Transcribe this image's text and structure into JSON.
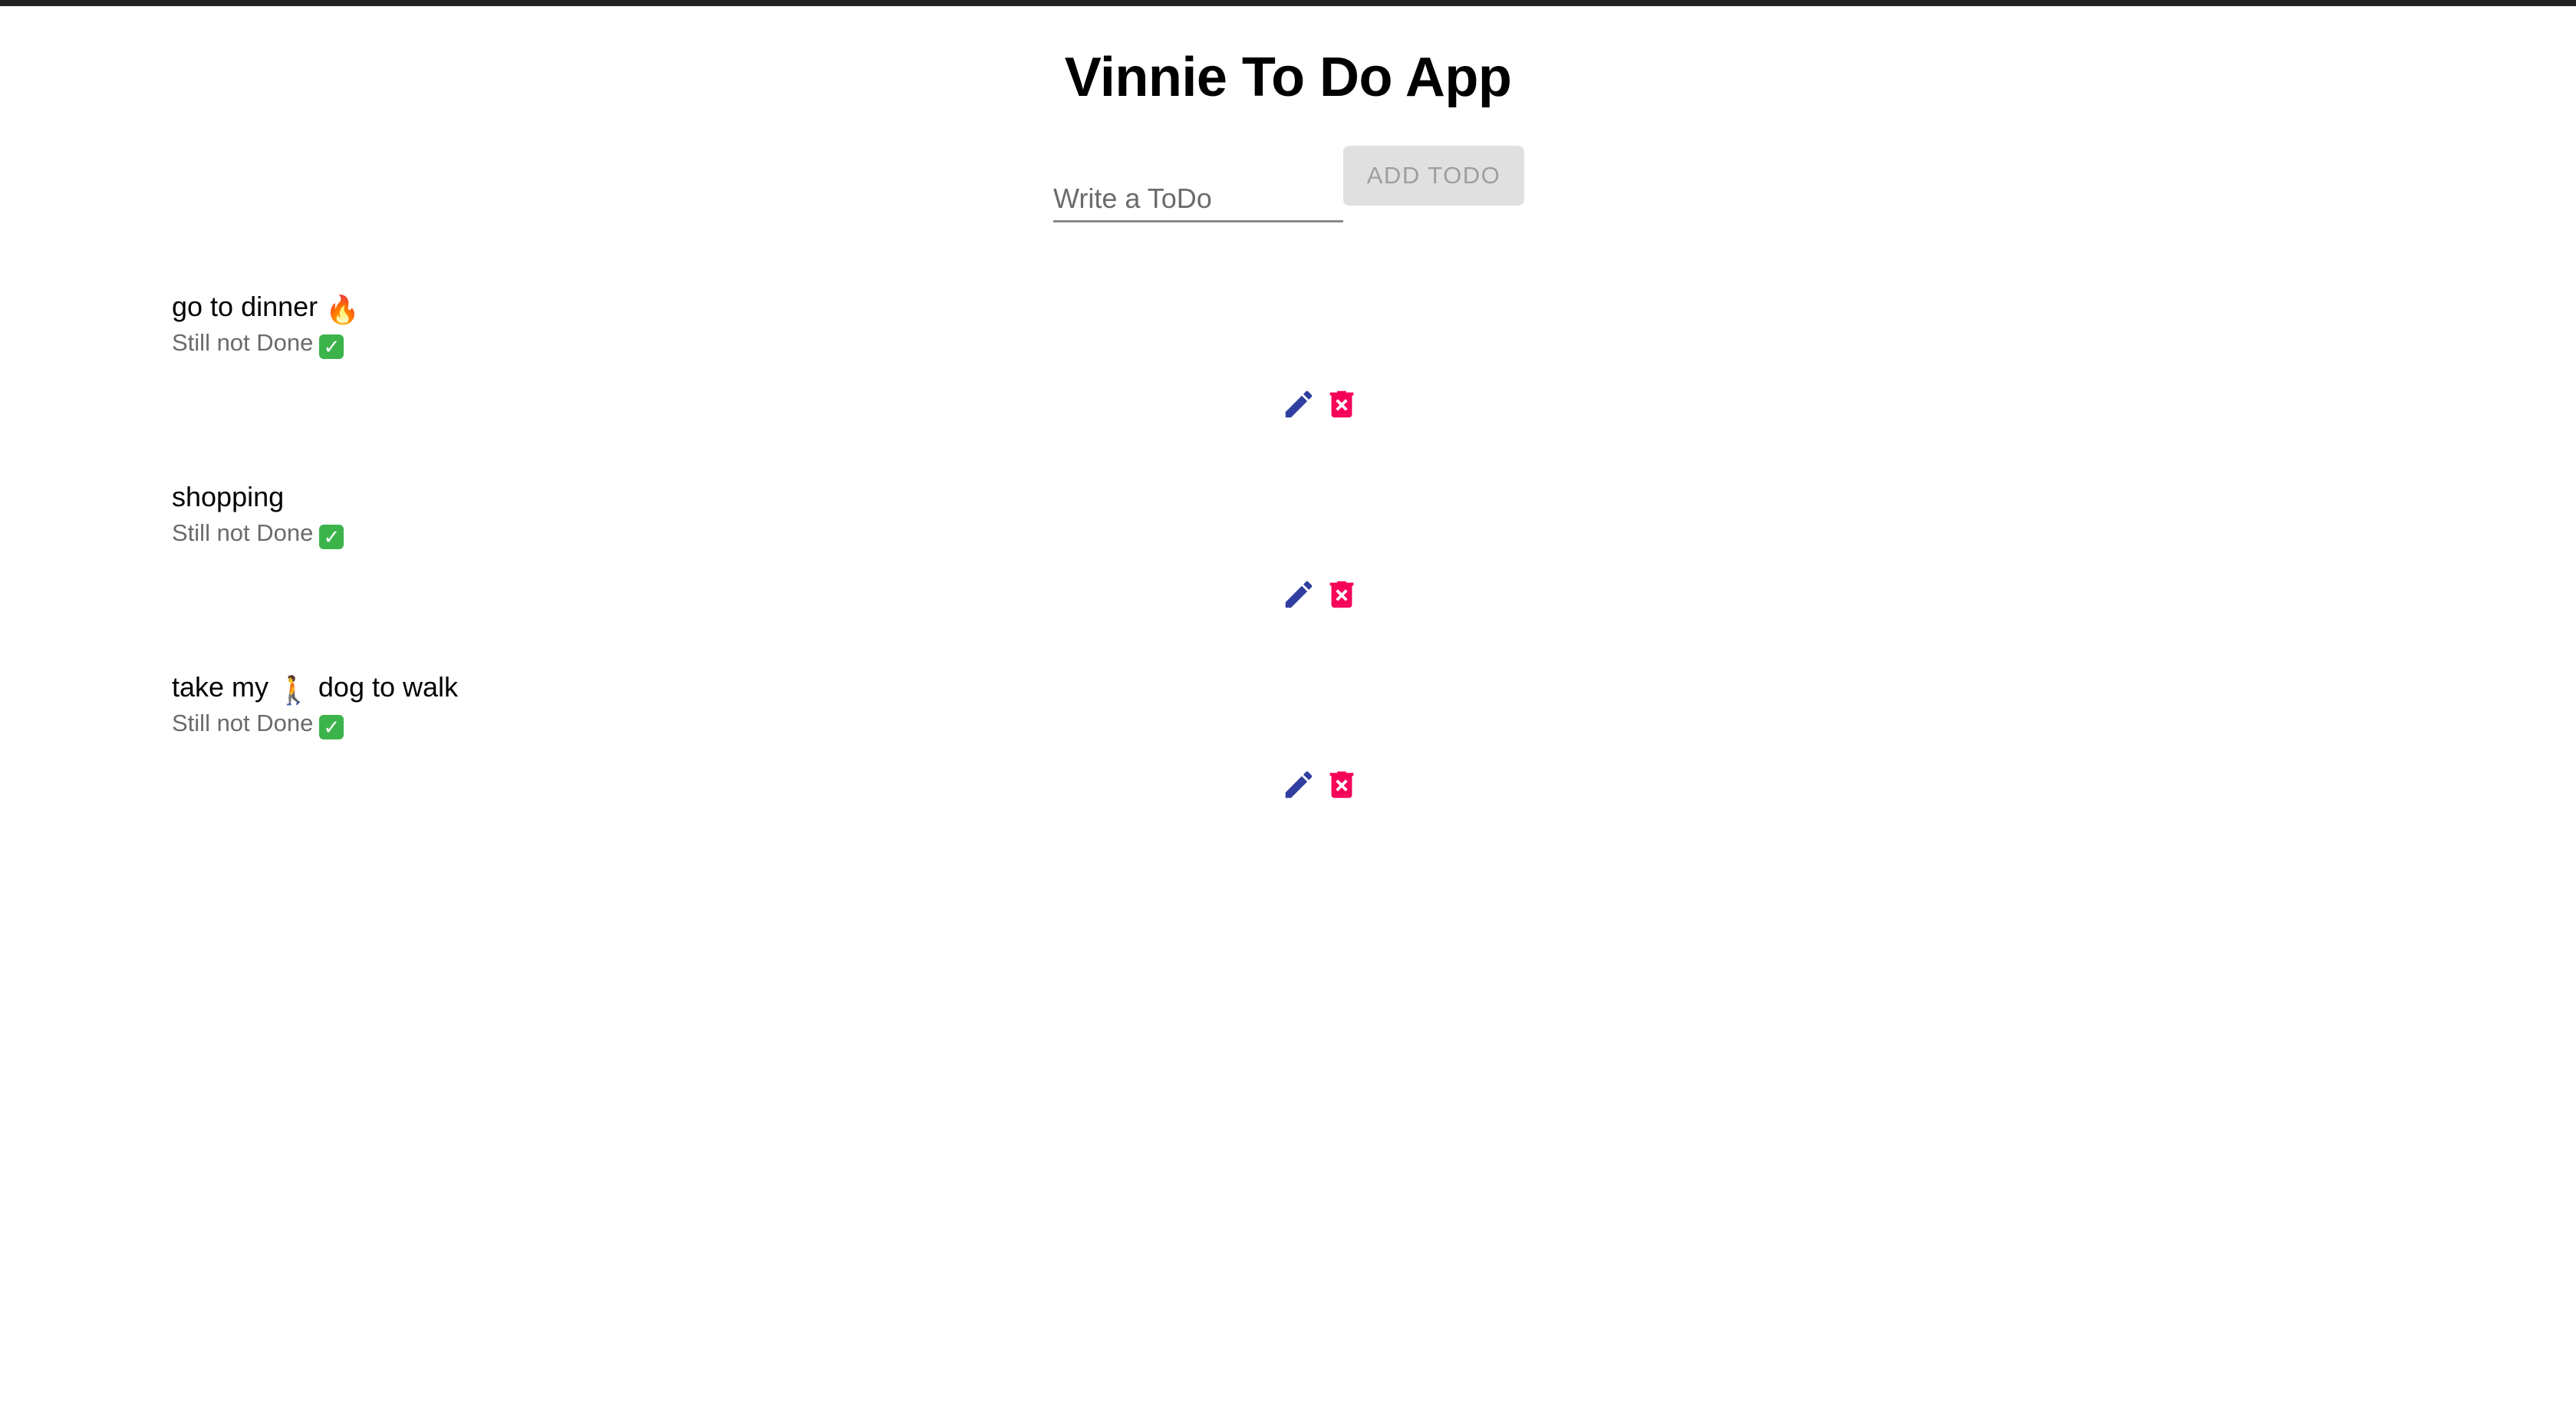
{
  "app": {
    "title": "Vinnie To Do App"
  },
  "form": {
    "input_placeholder": "Write a ToDo",
    "input_value": "",
    "add_button_label": "ADD TODO"
  },
  "colors": {
    "edit_icon": "#303f9f",
    "delete_icon": "#f50057",
    "button_bg_disabled": "#e0e0e0",
    "status_check_bg": "#3cb44b"
  },
  "todos": [
    {
      "text": "go to dinner",
      "emoji": "🔥",
      "status": "Still not Done",
      "status_icon": "check-mark-button-icon",
      "edit_icon": "pencil-icon",
      "delete_icon": "trash-icon"
    },
    {
      "text": "shopping",
      "emoji": "",
      "status": "Still not Done",
      "status_icon": "check-mark-button-icon",
      "edit_icon": "pencil-icon",
      "delete_icon": "trash-icon"
    },
    {
      "text_before": "take my",
      "emoji": "🚶",
      "text_after": "dog to walk",
      "status": "Still not Done",
      "status_icon": "check-mark-button-icon",
      "edit_icon": "pencil-icon",
      "delete_icon": "trash-icon"
    }
  ]
}
